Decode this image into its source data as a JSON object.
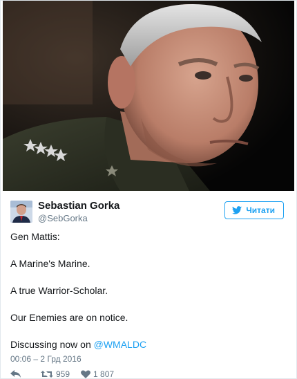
{
  "photo": {
    "alt_icon": "portrait-photo"
  },
  "author": {
    "display_name": "Sebastian Gorka",
    "handle": "@SebGorka"
  },
  "follow_button": {
    "label": "Читати",
    "icon": "twitter-bird-icon"
  },
  "tweet": {
    "line1": "Gen Mattis:",
    "line2": "A Marine's Marine.",
    "line3": "A true Warrior-Scholar.",
    "line4": "Our Enemies are on notice.",
    "line5_text": "Discussing now on ",
    "line5_mention": "@WMALDC"
  },
  "timestamp": "00:06 – 2 Грд 2016",
  "actions": {
    "retweets": "959",
    "likes": "1 807"
  },
  "colors": {
    "accent": "#1da1f2",
    "muted": "#657786",
    "text": "#14171a"
  }
}
